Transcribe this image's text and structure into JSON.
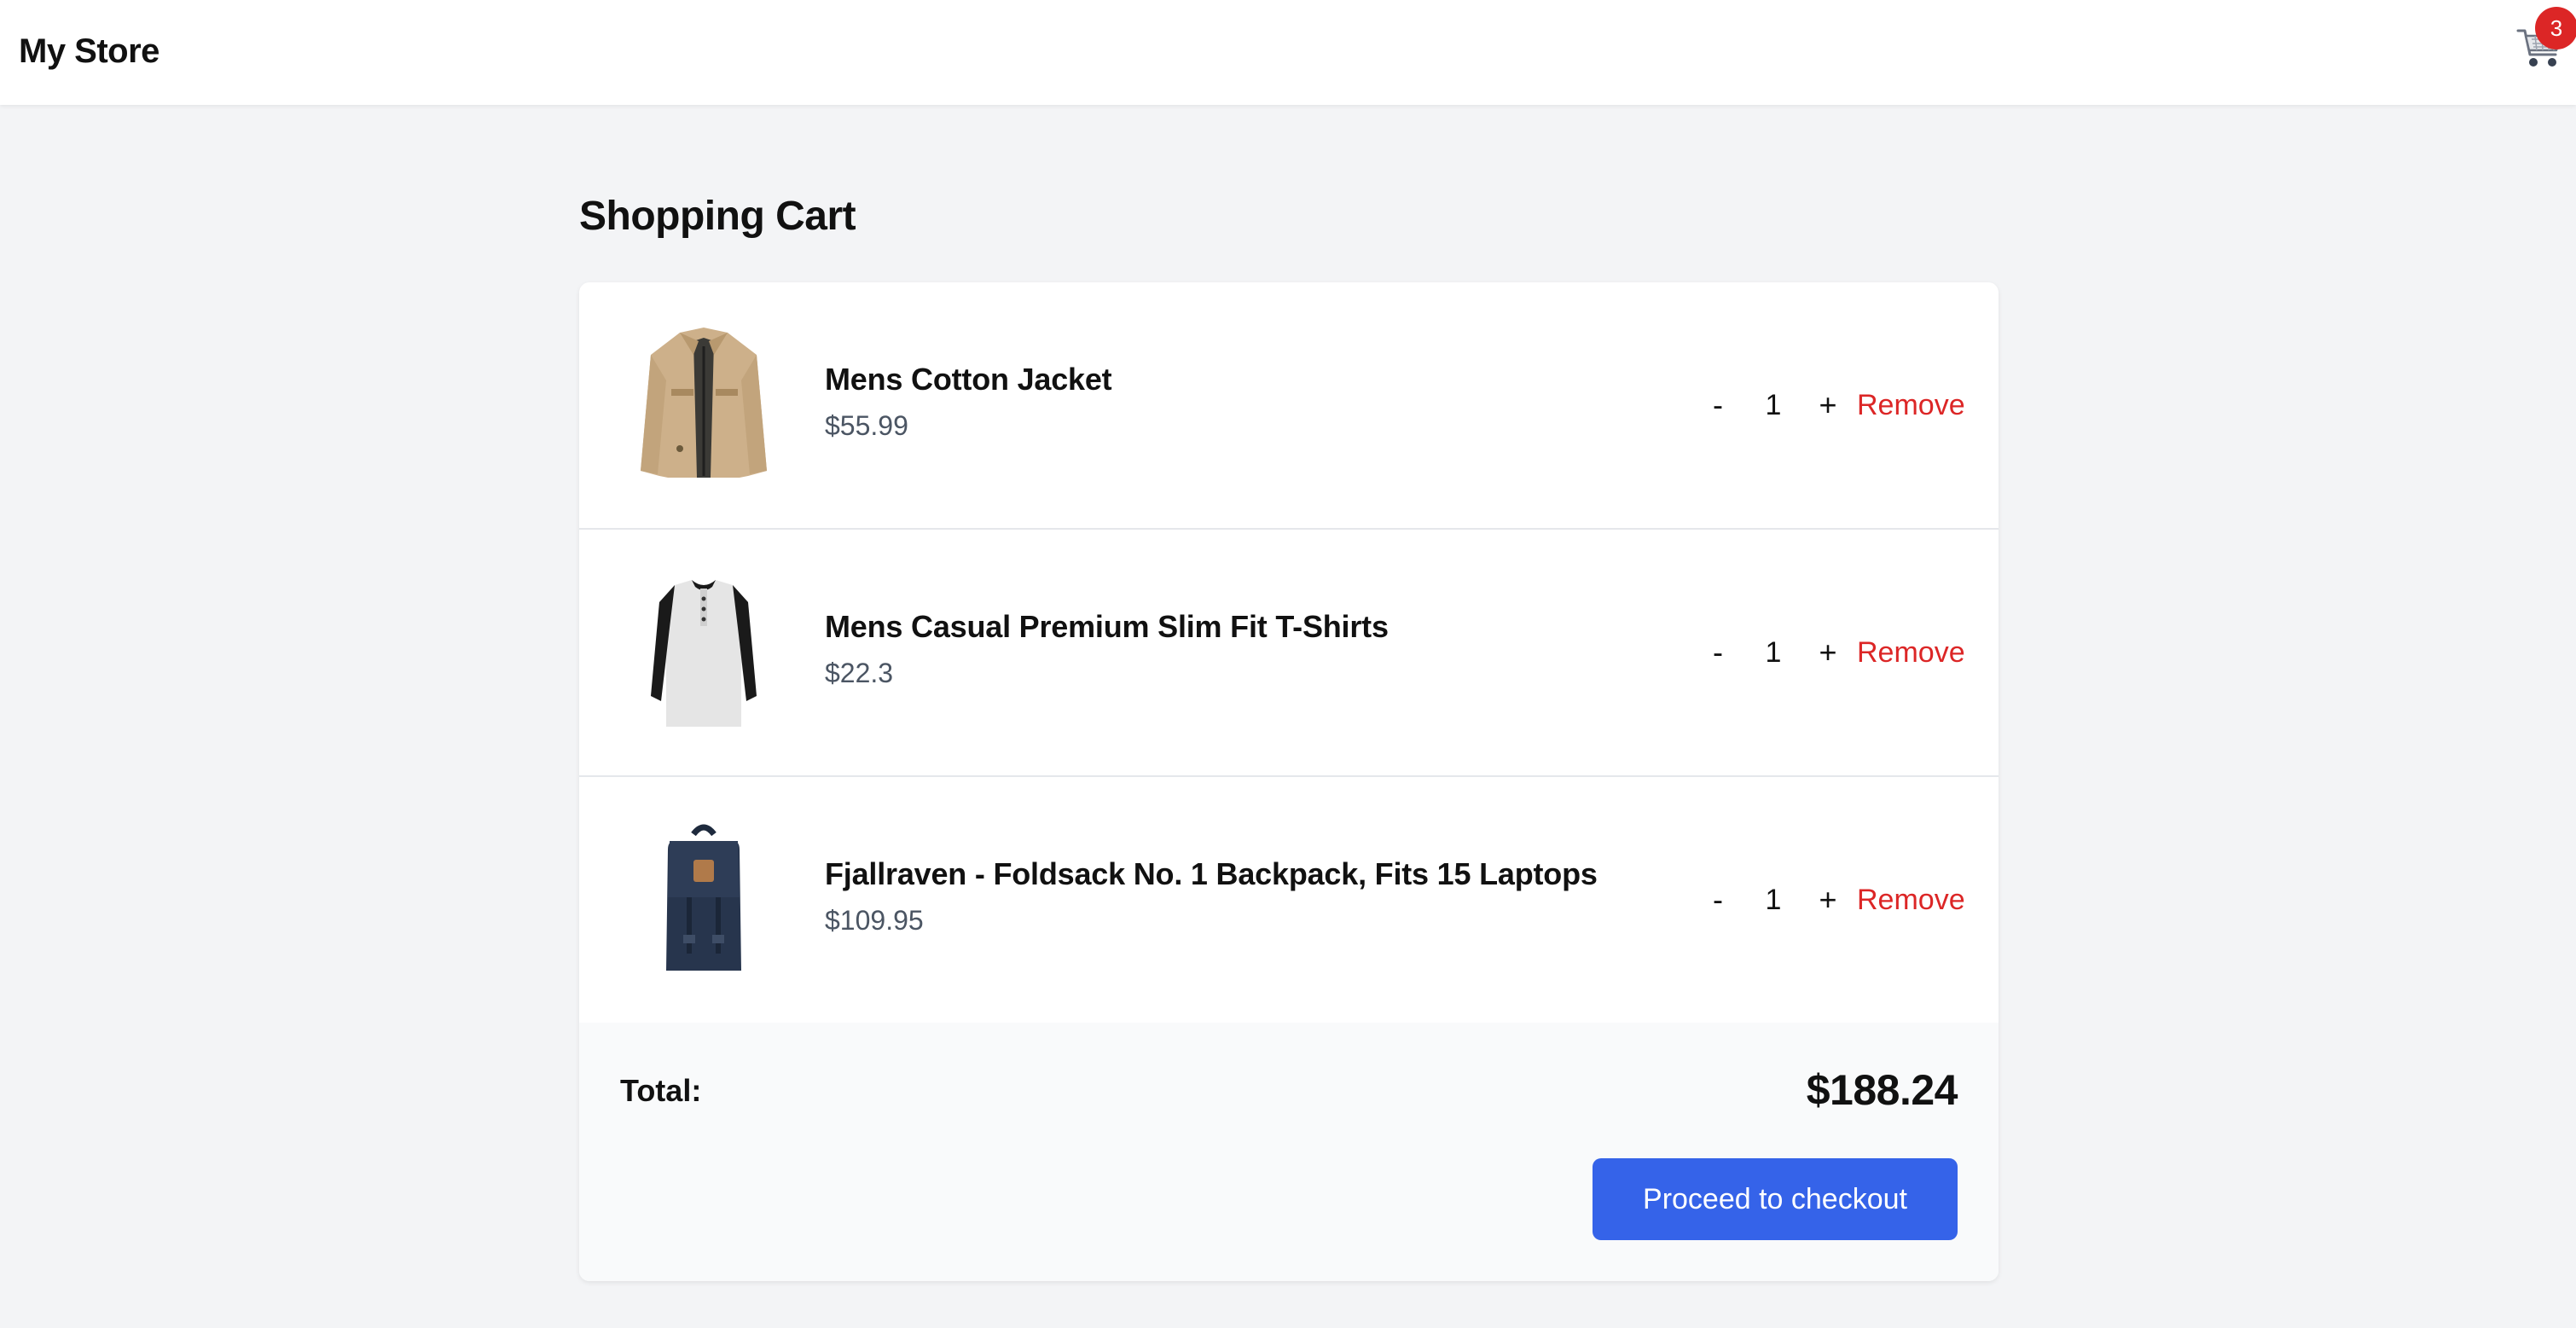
{
  "header": {
    "brand": "My Store",
    "cart_icon": "shopping-cart-icon",
    "cart_count": "3"
  },
  "page": {
    "title": "Shopping Cart"
  },
  "cart": {
    "items": [
      {
        "name": "Mens Cotton Jacket",
        "price": "$55.99",
        "quantity": "1",
        "image": "jacket-image",
        "minus": "-",
        "plus": "+",
        "remove": "Remove"
      },
      {
        "name": "Mens Casual Premium Slim Fit T-Shirts",
        "price": "$22.3",
        "quantity": "1",
        "image": "tshirt-image",
        "minus": "-",
        "plus": "+",
        "remove": "Remove"
      },
      {
        "name": "Fjallraven - Foldsack No. 1 Backpack, Fits 15 Laptops",
        "price": "$109.95",
        "quantity": "1",
        "image": "backpack-image",
        "minus": "-",
        "plus": "+",
        "remove": "Remove"
      }
    ],
    "total_label": "Total:",
    "total_value": "$188.24",
    "checkout_label": "Proceed to checkout"
  },
  "colors": {
    "accent": "#3563e9",
    "danger": "#dc2626",
    "background": "#f3f4f6"
  }
}
